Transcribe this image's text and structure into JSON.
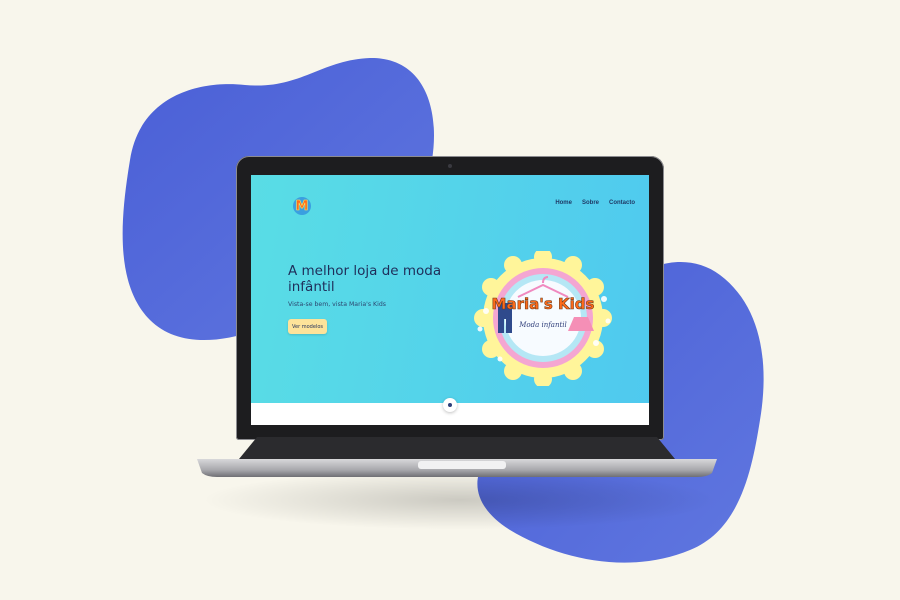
{
  "colors": {
    "background": "#f8f6ec",
    "blob": "#5569d9",
    "screen_gradient_start": "#59dde5",
    "screen_gradient_end": "#4fc9ef",
    "cta_background": "#fde39a",
    "title_text": "#1f2e5a"
  },
  "site": {
    "logo_letter": "M",
    "nav": [
      "Home",
      "Sobre",
      "Contacto"
    ],
    "hero": {
      "title": "A melhor loja de moda infântil",
      "subtitle": "Vista-se bem, vista Maria's Kids",
      "cta_label": "Ver modelos"
    },
    "badge": {
      "brand": "Maria's Kids",
      "tagline": "Moda infantil"
    }
  },
  "icons": {
    "scroll_down": "dot-circle-icon",
    "logo": "m-logo-icon"
  }
}
